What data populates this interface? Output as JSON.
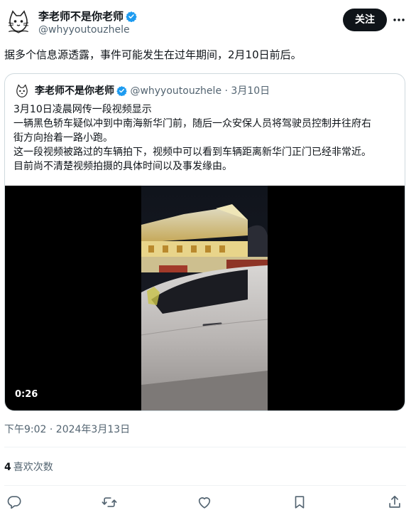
{
  "author": {
    "name": "李老师不是你老师",
    "handle": "@whyyoutouzhele",
    "verified": true
  },
  "follow_label": "关注",
  "tweet_text": "据多个信息源透露，事件可能发生在过年期间，2月10日前后。",
  "quote": {
    "name": "李老师不是你老师",
    "handle": "@whyyoutouzhele",
    "separator": "·",
    "date": "3月10日",
    "lines": [
      "3月10日凌晨网传一段视频显示",
      "一辆黑色轿车疑似冲到中南海新华门前，随后一众安保人员将驾驶员控制并往府右",
      "街方向抬着一路小跑。",
      "这一段视频被路过的车辆拍下，视频中可以看到车辆距离新华门正门已经非常近。",
      "目前尚不清楚视频拍摄的具体时间以及事发缘由。"
    ],
    "video_duration": "0:26"
  },
  "timestamp": "下午9:02 · 2024年3月13日",
  "stats": {
    "likes_count": "4",
    "likes_label": "喜欢次数"
  },
  "colors": {
    "accent": "#1d9bf0",
    "text_primary": "#0f1419",
    "text_secondary": "#536471",
    "border": "#cfd9de",
    "follow_bg": "#0f1419"
  },
  "icons": {
    "verified": "verified-badge-icon",
    "more": "more-icon",
    "reply": "reply-icon",
    "retweet": "retweet-icon",
    "like": "heart-icon",
    "bookmark": "bookmark-icon",
    "share": "share-icon"
  }
}
